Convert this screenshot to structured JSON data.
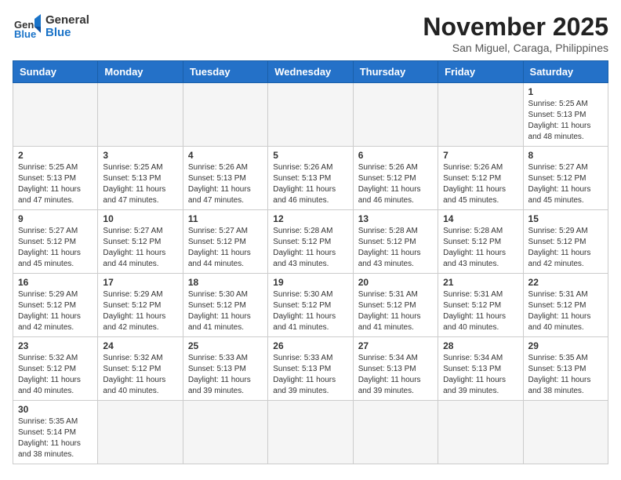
{
  "header": {
    "logo_line1": "General",
    "logo_line2": "Blue",
    "month_title": "November 2025",
    "subtitle": "San Miguel, Caraga, Philippines"
  },
  "weekdays": [
    "Sunday",
    "Monday",
    "Tuesday",
    "Wednesday",
    "Thursday",
    "Friday",
    "Saturday"
  ],
  "weeks": [
    [
      {
        "day": "",
        "info": ""
      },
      {
        "day": "",
        "info": ""
      },
      {
        "day": "",
        "info": ""
      },
      {
        "day": "",
        "info": ""
      },
      {
        "day": "",
        "info": ""
      },
      {
        "day": "",
        "info": ""
      },
      {
        "day": "1",
        "info": "Sunrise: 5:25 AM\nSunset: 5:13 PM\nDaylight: 11 hours\nand 48 minutes."
      }
    ],
    [
      {
        "day": "2",
        "info": "Sunrise: 5:25 AM\nSunset: 5:13 PM\nDaylight: 11 hours\nand 47 minutes."
      },
      {
        "day": "3",
        "info": "Sunrise: 5:25 AM\nSunset: 5:13 PM\nDaylight: 11 hours\nand 47 minutes."
      },
      {
        "day": "4",
        "info": "Sunrise: 5:26 AM\nSunset: 5:13 PM\nDaylight: 11 hours\nand 47 minutes."
      },
      {
        "day": "5",
        "info": "Sunrise: 5:26 AM\nSunset: 5:13 PM\nDaylight: 11 hours\nand 46 minutes."
      },
      {
        "day": "6",
        "info": "Sunrise: 5:26 AM\nSunset: 5:12 PM\nDaylight: 11 hours\nand 46 minutes."
      },
      {
        "day": "7",
        "info": "Sunrise: 5:26 AM\nSunset: 5:12 PM\nDaylight: 11 hours\nand 45 minutes."
      },
      {
        "day": "8",
        "info": "Sunrise: 5:27 AM\nSunset: 5:12 PM\nDaylight: 11 hours\nand 45 minutes."
      }
    ],
    [
      {
        "day": "9",
        "info": "Sunrise: 5:27 AM\nSunset: 5:12 PM\nDaylight: 11 hours\nand 45 minutes."
      },
      {
        "day": "10",
        "info": "Sunrise: 5:27 AM\nSunset: 5:12 PM\nDaylight: 11 hours\nand 44 minutes."
      },
      {
        "day": "11",
        "info": "Sunrise: 5:27 AM\nSunset: 5:12 PM\nDaylight: 11 hours\nand 44 minutes."
      },
      {
        "day": "12",
        "info": "Sunrise: 5:28 AM\nSunset: 5:12 PM\nDaylight: 11 hours\nand 43 minutes."
      },
      {
        "day": "13",
        "info": "Sunrise: 5:28 AM\nSunset: 5:12 PM\nDaylight: 11 hours\nand 43 minutes."
      },
      {
        "day": "14",
        "info": "Sunrise: 5:28 AM\nSunset: 5:12 PM\nDaylight: 11 hours\nand 43 minutes."
      },
      {
        "day": "15",
        "info": "Sunrise: 5:29 AM\nSunset: 5:12 PM\nDaylight: 11 hours\nand 42 minutes."
      }
    ],
    [
      {
        "day": "16",
        "info": "Sunrise: 5:29 AM\nSunset: 5:12 PM\nDaylight: 11 hours\nand 42 minutes."
      },
      {
        "day": "17",
        "info": "Sunrise: 5:29 AM\nSunset: 5:12 PM\nDaylight: 11 hours\nand 42 minutes."
      },
      {
        "day": "18",
        "info": "Sunrise: 5:30 AM\nSunset: 5:12 PM\nDaylight: 11 hours\nand 41 minutes."
      },
      {
        "day": "19",
        "info": "Sunrise: 5:30 AM\nSunset: 5:12 PM\nDaylight: 11 hours\nand 41 minutes."
      },
      {
        "day": "20",
        "info": "Sunrise: 5:31 AM\nSunset: 5:12 PM\nDaylight: 11 hours\nand 41 minutes."
      },
      {
        "day": "21",
        "info": "Sunrise: 5:31 AM\nSunset: 5:12 PM\nDaylight: 11 hours\nand 40 minutes."
      },
      {
        "day": "22",
        "info": "Sunrise: 5:31 AM\nSunset: 5:12 PM\nDaylight: 11 hours\nand 40 minutes."
      }
    ],
    [
      {
        "day": "23",
        "info": "Sunrise: 5:32 AM\nSunset: 5:12 PM\nDaylight: 11 hours\nand 40 minutes."
      },
      {
        "day": "24",
        "info": "Sunrise: 5:32 AM\nSunset: 5:12 PM\nDaylight: 11 hours\nand 40 minutes."
      },
      {
        "day": "25",
        "info": "Sunrise: 5:33 AM\nSunset: 5:13 PM\nDaylight: 11 hours\nand 39 minutes."
      },
      {
        "day": "26",
        "info": "Sunrise: 5:33 AM\nSunset: 5:13 PM\nDaylight: 11 hours\nand 39 minutes."
      },
      {
        "day": "27",
        "info": "Sunrise: 5:34 AM\nSunset: 5:13 PM\nDaylight: 11 hours\nand 39 minutes."
      },
      {
        "day": "28",
        "info": "Sunrise: 5:34 AM\nSunset: 5:13 PM\nDaylight: 11 hours\nand 39 minutes."
      },
      {
        "day": "29",
        "info": "Sunrise: 5:35 AM\nSunset: 5:13 PM\nDaylight: 11 hours\nand 38 minutes."
      }
    ],
    [
      {
        "day": "30",
        "info": "Sunrise: 5:35 AM\nSunset: 5:14 PM\nDaylight: 11 hours\nand 38 minutes."
      },
      {
        "day": "",
        "info": ""
      },
      {
        "day": "",
        "info": ""
      },
      {
        "day": "",
        "info": ""
      },
      {
        "day": "",
        "info": ""
      },
      {
        "day": "",
        "info": ""
      },
      {
        "day": "",
        "info": ""
      }
    ]
  ]
}
